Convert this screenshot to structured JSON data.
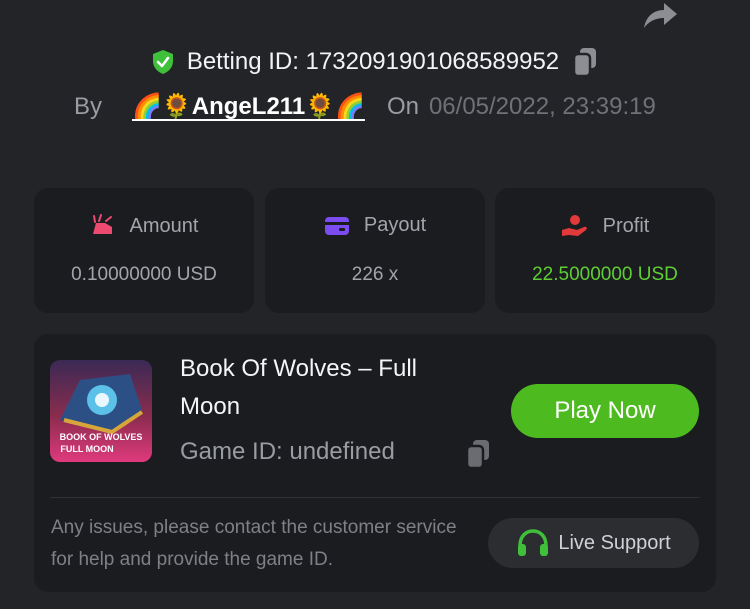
{
  "header": {
    "betting_id_label": "Betting ID: 1732091901068589952",
    "by_label": "By",
    "username": "🌈🌻AngeL211🌻🌈",
    "on_label": "On",
    "datetime": "06/05/2022, 23:39:19"
  },
  "stats": [
    {
      "label": "Amount",
      "value": "0.10000000 USD",
      "icon": "amount-icon"
    },
    {
      "label": "Payout",
      "value": "226 x",
      "icon": "card-icon"
    },
    {
      "label": "Profit",
      "value": "22.5000000 USD",
      "icon": "hand-coin-icon"
    }
  ],
  "game": {
    "title": "Book Of Wolves – Full Moon",
    "game_id_label": "Game ID: undefined",
    "thumb_text_line1": "BOOK OF WOLVES",
    "thumb_text_line2": "FULL MOON",
    "play_label": "Play Now"
  },
  "support": {
    "message": "Any issues, please contact the customer service for help and provide the game ID.",
    "button_label": "Live Support"
  },
  "colors": {
    "background": "#232427",
    "panel": "#1b1c1f",
    "accent_green": "#4dbb1f",
    "profit_green": "#5fce34",
    "amount_icon": "#ec4a70",
    "payout_icon": "#7b4df0",
    "profit_icon": "#e23a3a"
  }
}
